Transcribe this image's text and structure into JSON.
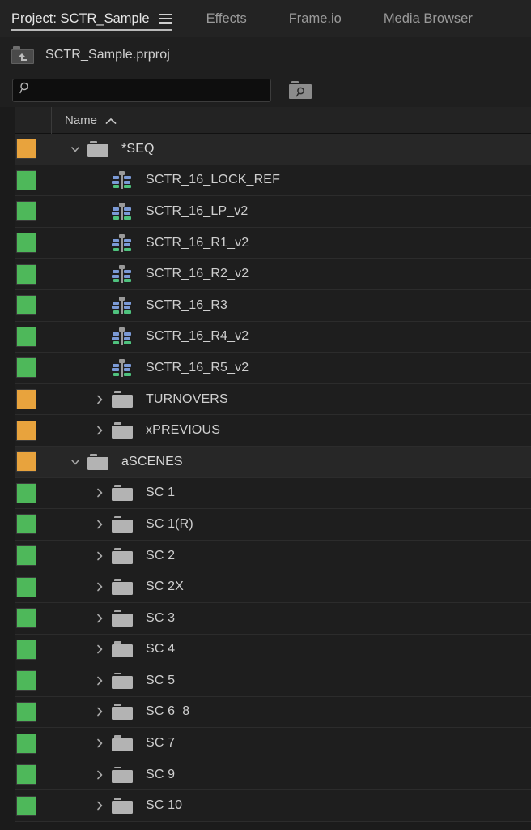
{
  "tabs": [
    {
      "label": "Project: SCTR_Sample",
      "active": true,
      "menu_icon": "hamburger-menu-icon"
    },
    {
      "label": "Effects",
      "active": false,
      "menu_icon": null
    },
    {
      "label": "Frame.io",
      "active": false,
      "menu_icon": null
    },
    {
      "label": "Media Browser",
      "active": false,
      "menu_icon": null
    }
  ],
  "subheader": {
    "parent_bin_icon": "folder-up-arrow-icon",
    "project_name": "SCTR_Sample.prproj"
  },
  "search": {
    "icon": "magnifier-icon",
    "value": "",
    "placeholder": "",
    "find_button_icon": "find-bin-icon"
  },
  "columns": [
    {
      "label": "",
      "type": "label-swatch"
    },
    {
      "label": "Name",
      "sort": "ascending",
      "sort_icon": "caret-up-icon"
    }
  ],
  "colors": {
    "bin_label": "#E8A33D",
    "sequence_label": "#4EB85A",
    "row_bg": "#1E1E1E",
    "row_bg_highlight": "#272727",
    "panel_bg": "#1B1B1B",
    "header_bg": "#232323",
    "text": "#CFCFCF",
    "seq_icon_blue": "#7B9AD6",
    "seq_icon_green": "#4FC27E",
    "bin_icon_gray": "#B3B3B3"
  },
  "rows": [
    {
      "name": "*SEQ",
      "type": "bin",
      "swatch": "#E8A33D",
      "indent": 0,
      "twisty": "expanded",
      "highlight": true
    },
    {
      "name": "SCTR_16_LOCK_REF",
      "type": "sequence",
      "swatch": "#4EB85A",
      "indent": 1,
      "twisty": "none",
      "highlight": false
    },
    {
      "name": "SCTR_16_LP_v2",
      "type": "sequence",
      "swatch": "#4EB85A",
      "indent": 1,
      "twisty": "none",
      "highlight": false
    },
    {
      "name": "SCTR_16_R1_v2",
      "type": "sequence",
      "swatch": "#4EB85A",
      "indent": 1,
      "twisty": "none",
      "highlight": false
    },
    {
      "name": "SCTR_16_R2_v2",
      "type": "sequence",
      "swatch": "#4EB85A",
      "indent": 1,
      "twisty": "none",
      "highlight": false
    },
    {
      "name": "SCTR_16_R3",
      "type": "sequence",
      "swatch": "#4EB85A",
      "indent": 1,
      "twisty": "none",
      "highlight": false
    },
    {
      "name": "SCTR_16_R4_v2",
      "type": "sequence",
      "swatch": "#4EB85A",
      "indent": 1,
      "twisty": "none",
      "highlight": false
    },
    {
      "name": "SCTR_16_R5_v2",
      "type": "sequence",
      "swatch": "#4EB85A",
      "indent": 1,
      "twisty": "none",
      "highlight": false
    },
    {
      "name": "TURNOVERS",
      "type": "bin",
      "swatch": "#E8A33D",
      "indent": 1,
      "twisty": "collapsed",
      "highlight": false
    },
    {
      "name": "xPREVIOUS",
      "type": "bin",
      "swatch": "#E8A33D",
      "indent": 1,
      "twisty": "collapsed",
      "highlight": false
    },
    {
      "name": "aSCENES",
      "type": "bin",
      "swatch": "#E8A33D",
      "indent": 0,
      "twisty": "expanded",
      "highlight": true
    },
    {
      "name": "SC 1",
      "type": "bin",
      "swatch": "#4EB85A",
      "indent": 1,
      "twisty": "collapsed",
      "highlight": false
    },
    {
      "name": "SC 1(R)",
      "type": "bin",
      "swatch": "#4EB85A",
      "indent": 1,
      "twisty": "collapsed",
      "highlight": false
    },
    {
      "name": "SC 2",
      "type": "bin",
      "swatch": "#4EB85A",
      "indent": 1,
      "twisty": "collapsed",
      "highlight": false
    },
    {
      "name": "SC 2X",
      "type": "bin",
      "swatch": "#4EB85A",
      "indent": 1,
      "twisty": "collapsed",
      "highlight": false
    },
    {
      "name": "SC 3",
      "type": "bin",
      "swatch": "#4EB85A",
      "indent": 1,
      "twisty": "collapsed",
      "highlight": false
    },
    {
      "name": "SC 4",
      "type": "bin",
      "swatch": "#4EB85A",
      "indent": 1,
      "twisty": "collapsed",
      "highlight": false
    },
    {
      "name": "SC 5",
      "type": "bin",
      "swatch": "#4EB85A",
      "indent": 1,
      "twisty": "collapsed",
      "highlight": false
    },
    {
      "name": "SC 6_8",
      "type": "bin",
      "swatch": "#4EB85A",
      "indent": 1,
      "twisty": "collapsed",
      "highlight": false
    },
    {
      "name": "SC 7",
      "type": "bin",
      "swatch": "#4EB85A",
      "indent": 1,
      "twisty": "collapsed",
      "highlight": false
    },
    {
      "name": "SC 9",
      "type": "bin",
      "swatch": "#4EB85A",
      "indent": 1,
      "twisty": "collapsed",
      "highlight": false
    },
    {
      "name": "SC 10",
      "type": "bin",
      "swatch": "#4EB85A",
      "indent": 1,
      "twisty": "collapsed",
      "highlight": false
    }
  ]
}
